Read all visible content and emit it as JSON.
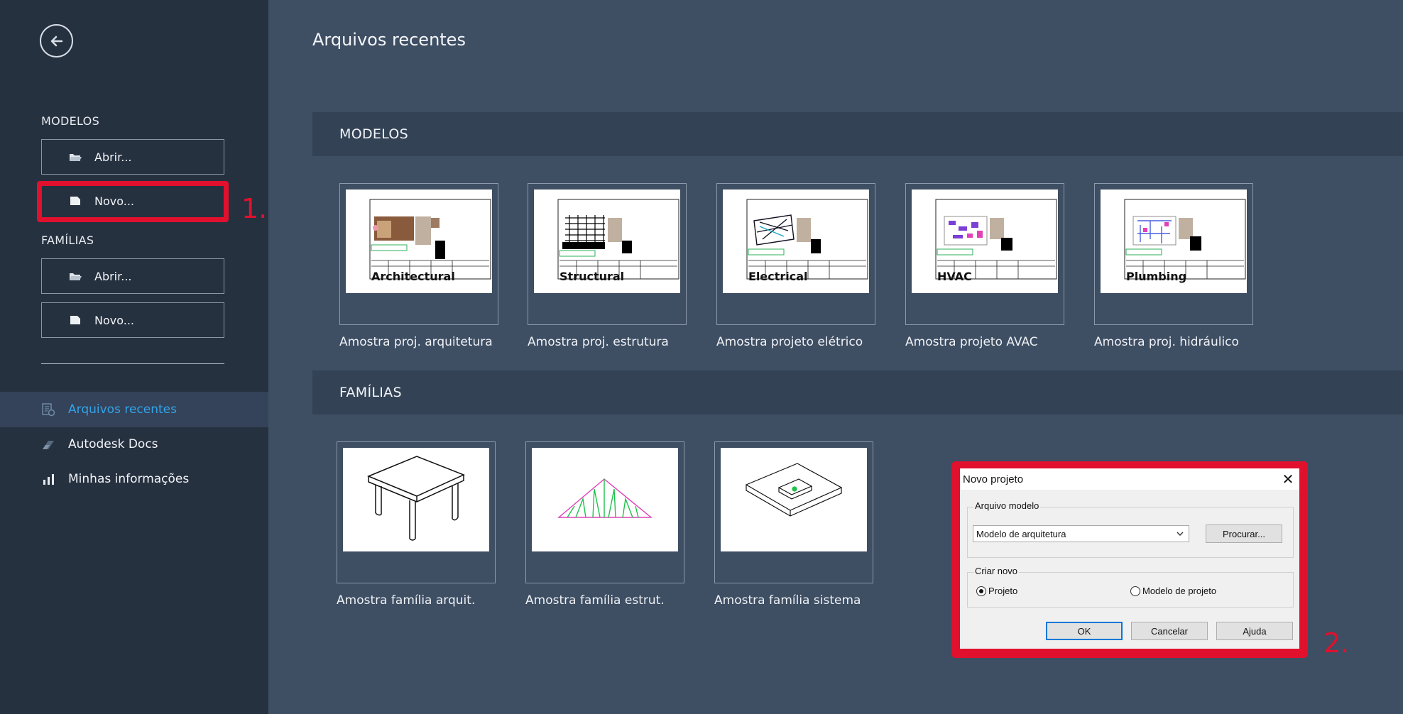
{
  "sidebar": {
    "models_label": "MODELOS",
    "models_open": "Abrir...",
    "models_new": "Novo...",
    "families_label": "FAMÍLIAS",
    "families_open": "Abrir...",
    "families_new": "Novo...",
    "nav": [
      {
        "label": "Arquivos recentes",
        "icon": "recent-files-icon"
      },
      {
        "label": "Autodesk Docs",
        "icon": "autodesk-docs-icon"
      },
      {
        "label": "Minhas informações",
        "icon": "bar-chart-icon"
      }
    ]
  },
  "annotations": {
    "step1": "1.",
    "step2": "2."
  },
  "main": {
    "title": "Arquivos recentes",
    "models_band": "MODELOS",
    "families_band": "FAMÍLIAS",
    "models": [
      {
        "thumb_label": "Architectural",
        "caption": "Amostra proj. arquitetura"
      },
      {
        "thumb_label": "Structural",
        "caption": "Amostra proj. estrutura"
      },
      {
        "thumb_label": "Electrical",
        "caption": "Amostra projeto elétrico"
      },
      {
        "thumb_label": "HVAC",
        "caption": "Amostra projeto AVAC"
      },
      {
        "thumb_label": "Plumbing",
        "caption": "Amostra proj. hidráulico"
      }
    ],
    "families": [
      {
        "caption": "Amostra família arquit."
      },
      {
        "caption": "Amostra família estrut."
      },
      {
        "caption": "Amostra família sistema"
      }
    ]
  },
  "dialog": {
    "title": "Novo projeto",
    "template_group": "Arquivo modelo",
    "template_value": "Modelo de arquitetura",
    "browse": "Procurar...",
    "create_group": "Criar novo",
    "radio_project": "Projeto",
    "radio_template": "Modelo de projeto",
    "ok": "OK",
    "cancel": "Cancelar",
    "help": "Ajuda"
  },
  "colors": {
    "accent": "#33a3e8",
    "highlight": "#e1102d",
    "sidebar": "#263140",
    "main": "#3e4e63"
  }
}
